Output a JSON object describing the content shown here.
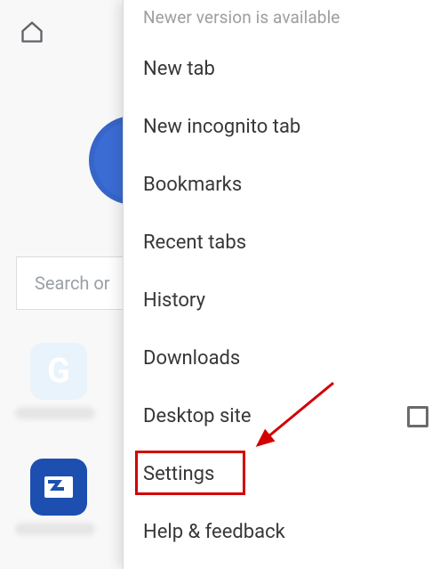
{
  "search": {
    "placeholder": "Search or"
  },
  "menu": {
    "notice": "Newer version is available",
    "items": {
      "new_tab": "New tab",
      "new_incognito": "New incognito tab",
      "bookmarks": "Bookmarks",
      "recent_tabs": "Recent tabs",
      "history": "History",
      "downloads": "Downloads",
      "desktop_site": "Desktop site",
      "settings": "Settings",
      "help": "Help & feedback"
    }
  },
  "shortcut_g": "G",
  "annotation": {
    "highlight_target": "settings"
  }
}
